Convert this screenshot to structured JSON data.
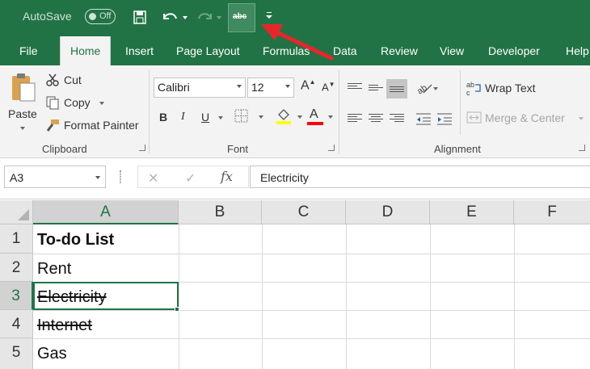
{
  "titlebar": {
    "autosave_label": "AutoSave",
    "autosave_state": "Off",
    "strikethrough_label": "abc"
  },
  "tabs": [
    "File",
    "Home",
    "Insert",
    "Page Layout",
    "Formulas",
    "Data",
    "Review",
    "View",
    "Developer",
    "Help"
  ],
  "clipboard": {
    "paste": "Paste",
    "cut": "Cut",
    "copy": "Copy",
    "format_painter": "Format Painter",
    "group": "Clipboard"
  },
  "font": {
    "name": "Calibri",
    "size": "12",
    "bold": "B",
    "italic": "I",
    "underline": "U",
    "color_letter": "A",
    "grow": "A",
    "shrink": "A",
    "group": "Font"
  },
  "alignment": {
    "wrap_text": "Wrap Text",
    "merge_center": "Merge & Center",
    "group": "Alignment"
  },
  "formula_bar": {
    "name_box": "A3",
    "cancel_glyph": "✕",
    "enter_glyph": "✓",
    "fx": "fx",
    "value": "Electricity"
  },
  "grid": {
    "columns": [
      "A",
      "B",
      "C",
      "D",
      "E",
      "F"
    ],
    "rows": [
      "1",
      "2",
      "3",
      "4",
      "5"
    ],
    "cells": {
      "A1": "To-do List",
      "A2": "Rent",
      "A3": "Electricity",
      "A4": "Internet",
      "A5": "Gas"
    },
    "selected_cell": "A3"
  },
  "colors": {
    "excel_green": "#217346",
    "ribbon_bg": "#f3f3f3",
    "arrow_red": "#e8262a",
    "highlight_yellow": "#ffff00",
    "font_red": "#ff0000"
  }
}
